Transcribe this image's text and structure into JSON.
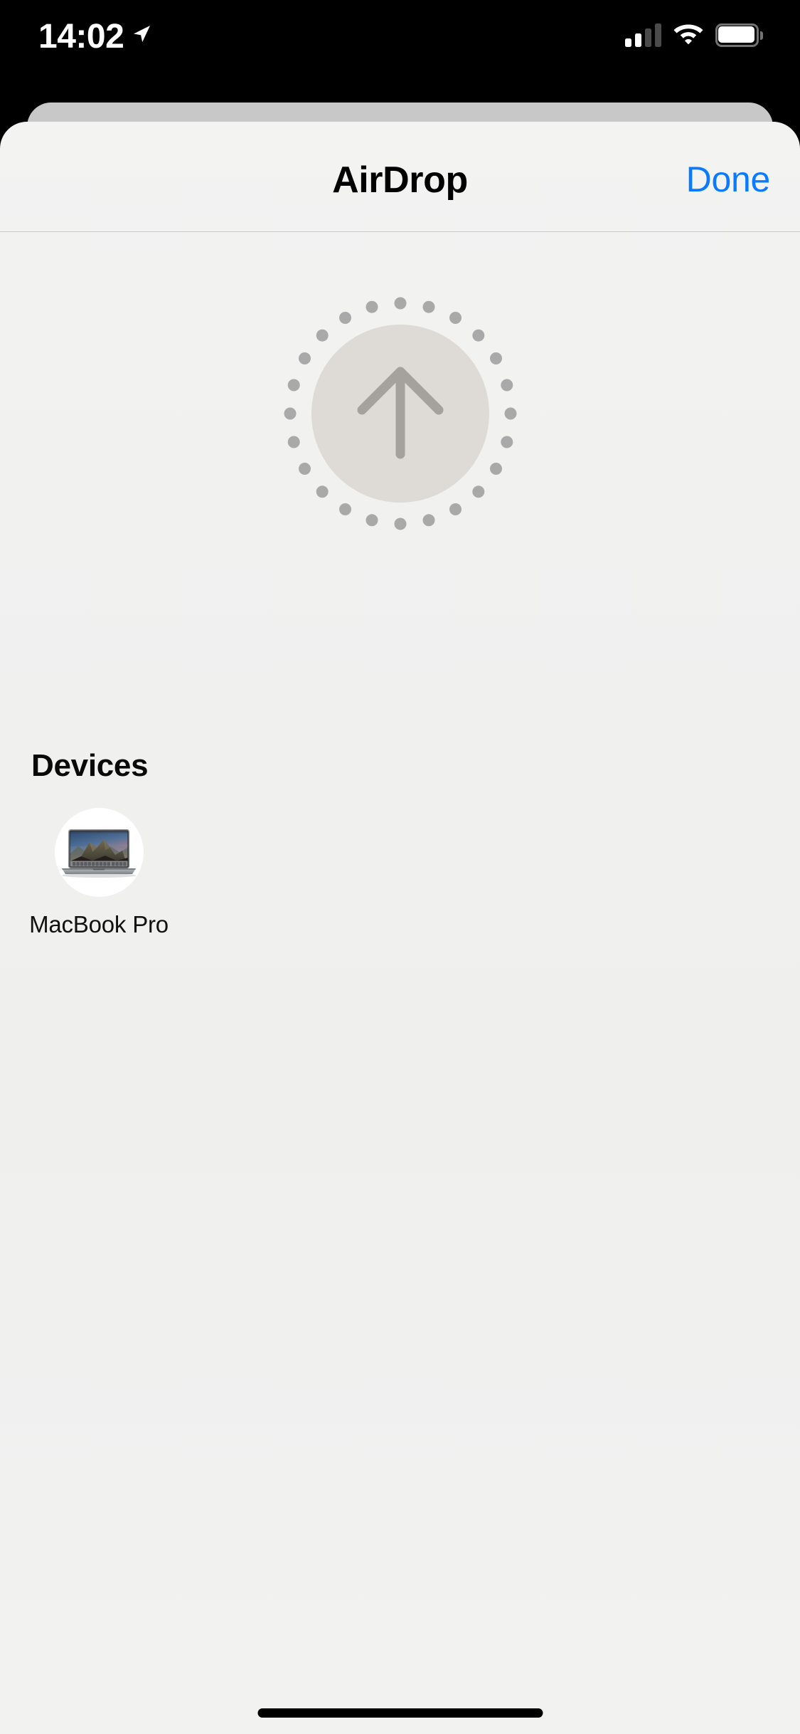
{
  "status_bar": {
    "time": "14:02",
    "location_icon": "location-arrow-icon",
    "cellular_icon": "cellular-signal-icon",
    "cellular_bars_total": 4,
    "cellular_bars_active": 2,
    "wifi_icon": "wifi-icon",
    "battery_icon": "battery-icon",
    "battery_full": true
  },
  "sheet": {
    "header": {
      "title": "AirDrop",
      "done_label": "Done",
      "done_color": "#0a7bff"
    },
    "airdrop_graphic": {
      "icon": "airdrop-upload-arrow-icon",
      "circle_color": "#dedbd7",
      "arrow_color": "#a5a19c",
      "dot_color": "#a9a9a9",
      "dot_count": 24
    },
    "devices": {
      "heading": "Devices",
      "items": [
        {
          "name": "MacBook Pro",
          "avatar_icon": "macbook-pro-icon"
        }
      ]
    }
  },
  "home_indicator": {
    "label": "home-indicator"
  }
}
